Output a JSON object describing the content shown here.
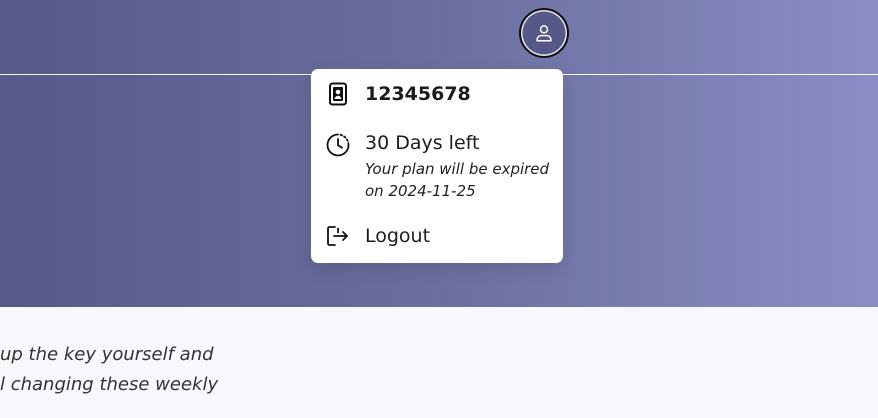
{
  "header": {
    "avatar_icon": "user-icon"
  },
  "account_menu": {
    "account_id": "12345678",
    "account_icon": "id-card-icon",
    "plan": {
      "icon": "clock-icon",
      "days_left": "30 Days left",
      "expiry_note_line1": "Your plan will be expired",
      "expiry_note_line2": "on 2024-11-25"
    },
    "logout": {
      "icon": "logout-icon",
      "label": "Logout"
    }
  },
  "content": {
    "line1": "up the key yourself and",
    "line2": "l changing these weekly"
  },
  "colors": {
    "header_gradient_start": "#565a88",
    "header_gradient_end": "#8a8ec4",
    "menu_bg": "#ffffff",
    "page_bg": "#f6f8fb"
  }
}
